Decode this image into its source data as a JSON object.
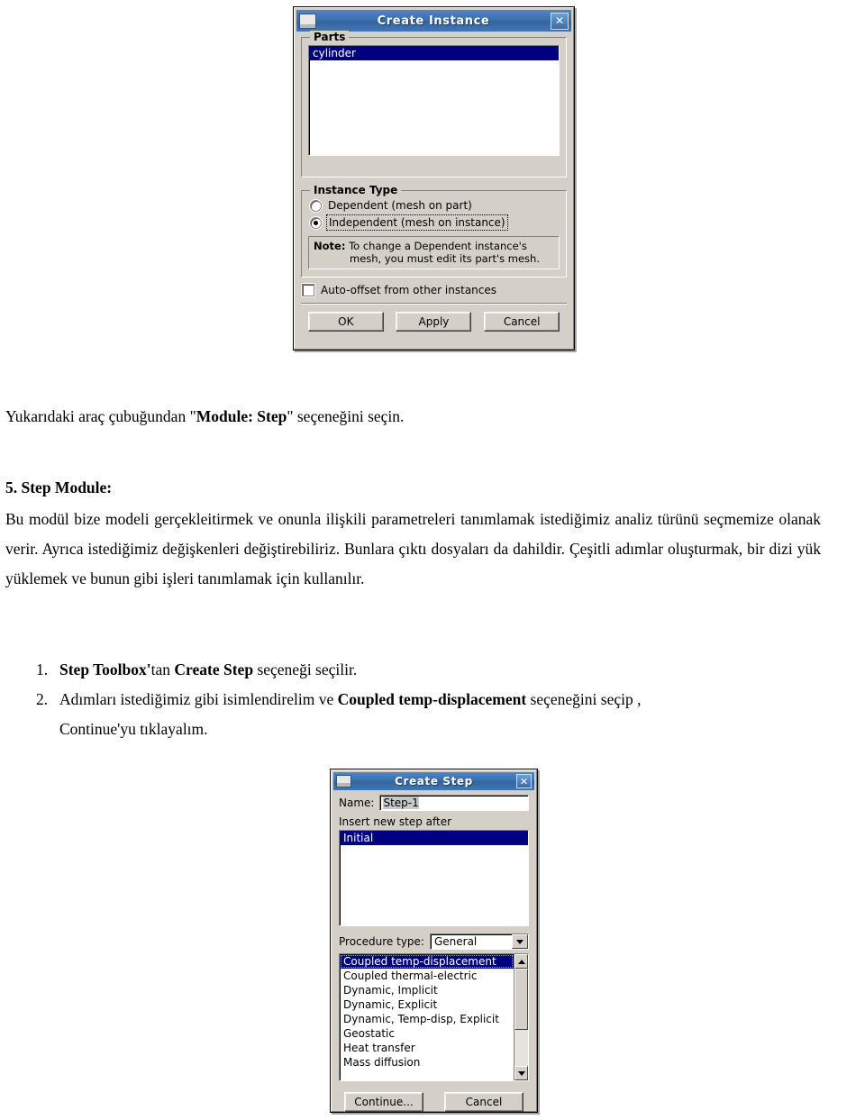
{
  "create_instance_dialog": {
    "title": "Create Instance",
    "window_icon": "window-icon",
    "close_icon": "✕",
    "parts_group": {
      "label": "Parts",
      "items": [
        {
          "label": "cylinder",
          "selected": true
        }
      ]
    },
    "instance_type_group": {
      "label": "Instance Type",
      "options": [
        {
          "label": "Dependent (mesh on part)",
          "selected": false
        },
        {
          "label": "Independent (mesh on instance)",
          "selected": true
        }
      ],
      "note_prefix": "Note:",
      "note_line1": "To change a Dependent instance's",
      "note_line2": "mesh, you must edit its part's mesh."
    },
    "auto_offset": {
      "label": "Auto-offset from other instances",
      "checked": false
    },
    "buttons": {
      "ok": "OK",
      "apply": "Apply",
      "cancel": "Cancel"
    }
  },
  "document": {
    "caption_line": {
      "pre": "Yukarıdaki araç çubuğundan \"",
      "bold": "Module: Step",
      "post": "\" seçeneğini seçin."
    },
    "heading": "5. Step Module:",
    "paragraph": "Bu modül bize modeli gerçekleitirmek ve onunla ilişkili parametreleri tanımlamak istediğimiz analiz türünü seçmemize olanak verir. Ayrıca istediğimiz değişkenleri değiştirebiliriz. Bunlara çıktı dosyaları da dahildir. Çeşitli adımlar oluşturmak, bir dizi yük yüklemek ve bunun gibi işleri tanımlamak için kullanılır.",
    "steps": [
      {
        "num": "1.",
        "b1": "Step Toolbox'",
        "t1": "tan ",
        "b2": "Create Step",
        "t2": " seçeneği seçilir."
      },
      {
        "num": "2.",
        "t1": "Adımları istediğimiz gibi isimlendirelim ve ",
        "b1": "Coupled temp-displacement",
        "t2": " seçeneğini seçip ,",
        "t3": "Continue'yu tıklayalım."
      }
    ]
  },
  "create_step_dialog": {
    "title": "Create Step",
    "window_icon": "window-icon",
    "close_icon": "✕",
    "name_label": "Name:",
    "name_value": "Step-1",
    "insert_after_label": "Insert new step after",
    "step_list": [
      {
        "label": "Initial",
        "selected": true
      }
    ],
    "procedure_type_label": "Procedure type:",
    "procedure_type_value": "General",
    "procedure_list": [
      {
        "label": "Coupled temp-displacement",
        "selected": true
      },
      {
        "label": "Coupled thermal-electric",
        "selected": false
      },
      {
        "label": "Dynamic, Implicit",
        "selected": false
      },
      {
        "label": "Dynamic, Explicit",
        "selected": false
      },
      {
        "label": "Dynamic, Temp-disp, Explicit",
        "selected": false
      },
      {
        "label": "Geostatic",
        "selected": false
      },
      {
        "label": "Heat transfer",
        "selected": false
      },
      {
        "label": "Mass diffusion",
        "selected": false
      }
    ],
    "buttons": {
      "continue": "Continue...",
      "cancel": "Cancel"
    }
  },
  "colors": {
    "dialog_face": "#d4d0c8",
    "titlebar_blue": "#3c6fae",
    "selection_navy": "#000080",
    "text": "#000000"
  }
}
